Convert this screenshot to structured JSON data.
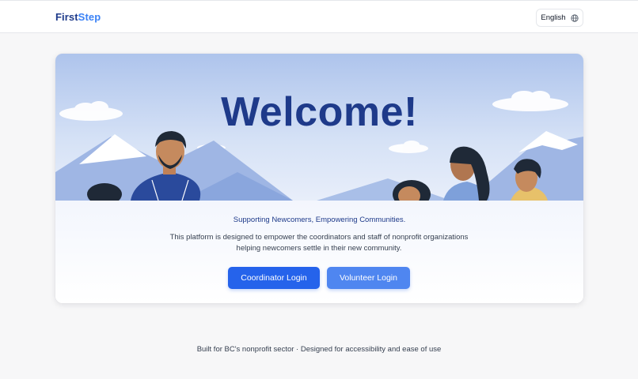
{
  "header": {
    "logo_part1": "First",
    "logo_part2": "Step",
    "language_label": "English",
    "language_icon": "globe-icon"
  },
  "hero": {
    "title": "Welcome!"
  },
  "card": {
    "tagline": "Supporting Newcomers, Empowering Communities.",
    "description": "This platform is designed to empower the coordinators and staff of nonprofit organizations helping newcomers settle in their new community."
  },
  "actions": {
    "coordinator_login": "Coordinator Login",
    "volunteer_login": "Volunteer Login"
  },
  "footer": {
    "text": "Built for BC's nonprofit sector · Designed for accessibility and ease of use"
  },
  "colors": {
    "brand_dark": "#1e3a8a",
    "brand_light": "#3b82f6",
    "primary_button": "#2563eb",
    "secondary_button": "#4f86f0"
  }
}
